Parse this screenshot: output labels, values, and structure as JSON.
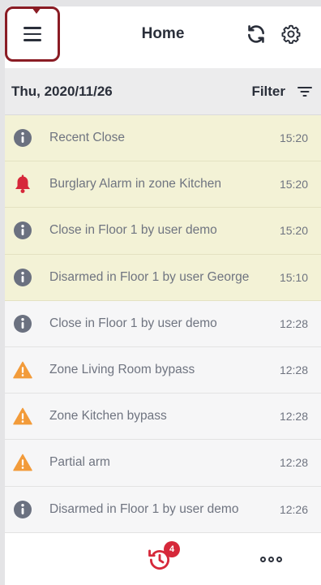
{
  "header": {
    "title": "Home",
    "menu_icon": "hamburger-menu-icon",
    "refresh_icon": "refresh-icon",
    "settings_icon": "gear-icon",
    "highlight_color": "#8a1c24"
  },
  "date_bar": {
    "date": "Thu, 2020/11/26",
    "filter_label": "Filter",
    "filter_icon": "filter-icon"
  },
  "events": [
    {
      "icon": "info",
      "message": "Recent Close",
      "time": "15:20",
      "highlight": true
    },
    {
      "icon": "alarm",
      "message": "Burglary Alarm in zone Kitchen",
      "time": "15:20",
      "highlight": true
    },
    {
      "icon": "info",
      "message": "Close in Floor 1 by user demo",
      "time": "15:20",
      "highlight": true
    },
    {
      "icon": "info",
      "message": "Disarmed in Floor 1 by user George",
      "time": "15:10",
      "highlight": true
    },
    {
      "icon": "info",
      "message": "Close in Floor 1 by user demo",
      "time": "12:28",
      "highlight": false
    },
    {
      "icon": "warning",
      "message": "Zone Living Room bypass",
      "time": "12:28",
      "highlight": false
    },
    {
      "icon": "warning",
      "message": "Zone Kitchen bypass",
      "time": "12:28",
      "highlight": false
    },
    {
      "icon": "warning",
      "message": "Partial arm",
      "time": "12:28",
      "highlight": false
    },
    {
      "icon": "info",
      "message": "Disarmed in Floor 1 by user demo",
      "time": "12:26",
      "highlight": false
    }
  ],
  "colors": {
    "info": "#6b7180",
    "alarm": "#d6283a",
    "warning": "#f29b3a",
    "highlight_row": "#f3f2d6"
  },
  "tabbar": {
    "history_icon": "history-icon",
    "history_badge": "4",
    "more_icon": "more-dots-icon"
  }
}
